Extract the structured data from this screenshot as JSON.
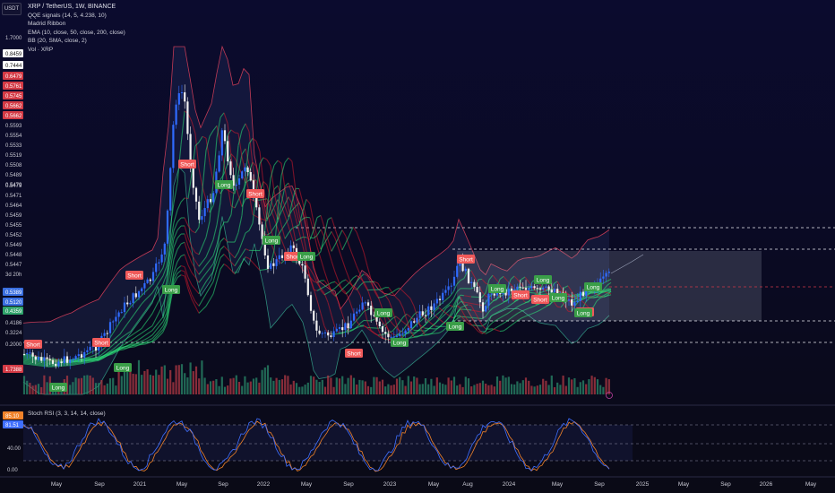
{
  "header": {
    "symbol_button": "USDT",
    "title": "XRP / TetherUS, 1W, BINANCE",
    "indicators": [
      "QQE signals (14, 5, 4.238, 10)",
      "Madrid Ribbon",
      "EMA (10, close, 50, close, 200, close)",
      "BB (20, SMA, close, 2)",
      "Vol · XRP"
    ]
  },
  "colors": {
    "up_candle": "#2f6bff",
    "down_candle": "#f0f0f0",
    "long_badge": "#3a9e48",
    "short_badge": "#f05a5a",
    "ribbon_green": "#2ee87a",
    "ribbon_red": "#d61a2b",
    "bb_band": "#c03a55",
    "stoch_k": "#3f6fff",
    "stoch_d": "#f0822a"
  },
  "chart_data": {
    "type": "candlestick",
    "x_labels": [
      "May",
      "Sep",
      "2021",
      "May",
      "Sep",
      "2022",
      "May",
      "Sep",
      "2023",
      "May",
      "Aug",
      "2024",
      "May",
      "Sep",
      "2025",
      "May",
      "Sep",
      "2026",
      "May"
    ],
    "price_scale": [
      "1.7000",
      "0.8459",
      "0.7444",
      "0.6479",
      "0.5761",
      "0.5745",
      "0.5662",
      "0.5662",
      "0.5593",
      "0.5554",
      "0.5533",
      "0.5519",
      "0.5508",
      "0.5489",
      "0.5479",
      "0.5479",
      "0.5471",
      "0.5464",
      "0.5459",
      "0.5455",
      "0.5452",
      "0.5449",
      "0.5448",
      "0.5447",
      "3d 20h",
      "0.5389",
      "0.5120",
      "0.4359",
      "0.4186",
      "0.3224",
      "0.2000",
      "1.7388"
    ],
    "signals": [
      {
        "label": "Short",
        "x_index": 0
      },
      {
        "label": "Long",
        "x_index": 1
      },
      {
        "label": "Short",
        "x_index": 2
      },
      {
        "label": "Long",
        "x_index": 3
      },
      {
        "label": "Short",
        "x_index": 4
      },
      {
        "label": "Long",
        "x_index": 5
      },
      {
        "label": "Short",
        "x_index": 6
      },
      {
        "label": "Long",
        "x_index": 7
      },
      {
        "label": "Short",
        "x_index": 8
      },
      {
        "label": "Long",
        "x_index": 9
      },
      {
        "label": "Short",
        "x_index": 10
      },
      {
        "label": "Long",
        "x_index": 11
      },
      {
        "label": "Short",
        "x_index": 12
      },
      {
        "label": "Long",
        "x_index": 13
      },
      {
        "label": "Long",
        "x_index": 14
      },
      {
        "label": "Long",
        "x_index": 15
      },
      {
        "label": "Short",
        "x_index": 16
      },
      {
        "label": "Long",
        "x_index": 17
      },
      {
        "label": "Short",
        "x_index": 18
      },
      {
        "label": "Long",
        "x_index": 19
      },
      {
        "label": "Short",
        "x_index": 20
      },
      {
        "label": "Long",
        "x_index": 21
      },
      {
        "label": "Short",
        "x_index": 22
      },
      {
        "label": "Long",
        "x_index": 23
      },
      {
        "label": "Long",
        "x_index": 24
      }
    ],
    "stoch_rsi": {
      "title": "Stoch RSI (3, 3, 14, 14, close)",
      "k_value": "85.10",
      "d_value": "81.51",
      "scale": [
        "40.00",
        "0.00"
      ]
    }
  }
}
